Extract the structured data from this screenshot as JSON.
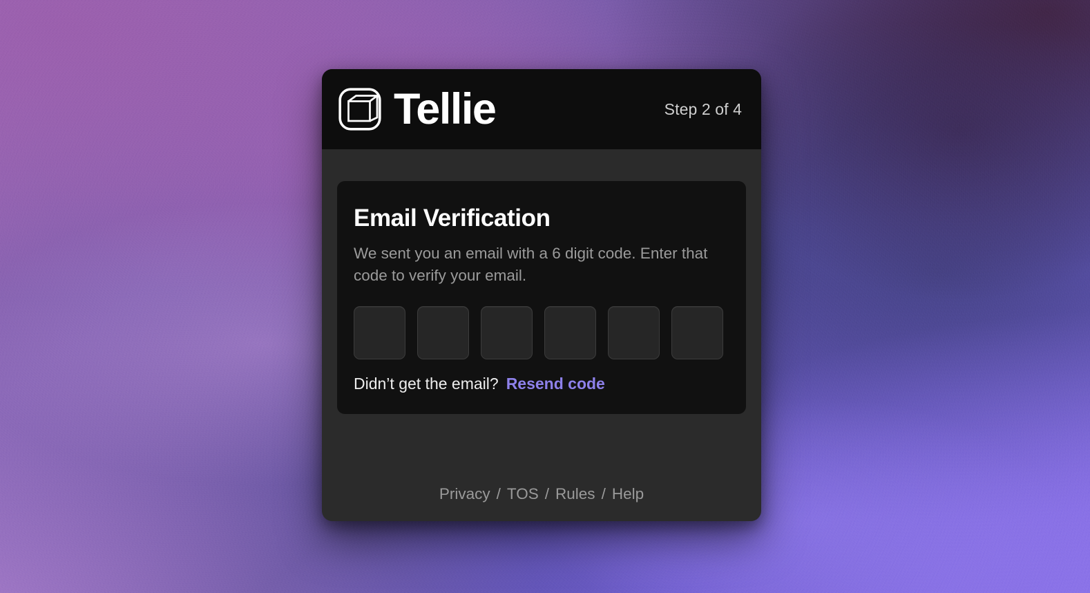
{
  "background": {
    "type": "noisy-purple-gradient",
    "colors": {
      "top_left": "#9a5fad",
      "top_right": "#432749",
      "center_right": "#474489",
      "bottom_right": "#8a72e8",
      "bottom_left": "#a87ccb"
    }
  },
  "modal": {
    "header": {
      "logo_icon": "tellie-cube-logo-icon",
      "brand_name": "Tellie",
      "step_label": "Step 2 of 4"
    },
    "panel": {
      "title": "Email Verification",
      "description": "We sent you an email with a 6 digit code. Enter that code to verify your email.",
      "otp": {
        "length": 6,
        "values": [
          "",
          "",
          "",
          "",
          "",
          ""
        ],
        "placeholder": ""
      },
      "resend": {
        "question": "Didn’t get the email?",
        "link_label": "Resend code",
        "link_color": "#8e81ea"
      }
    },
    "footer": {
      "separator": "/",
      "links": [
        {
          "label": "Privacy"
        },
        {
          "label": "TOS"
        },
        {
          "label": "Rules"
        },
        {
          "label": "Help"
        }
      ]
    }
  }
}
